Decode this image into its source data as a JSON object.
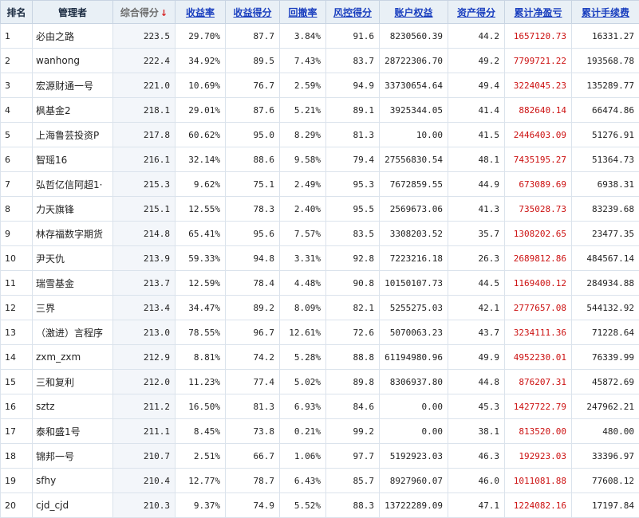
{
  "headers": {
    "rank": "排名",
    "manager": "管理者",
    "score": "综合得分",
    "sort_arrow": "↓",
    "return_rate": "收益率",
    "return_score": "收益得分",
    "drawdown": "回撤率",
    "risk_score": "风控得分",
    "equity": "账户权益",
    "asset_score": "资产得分",
    "net_profit": "累计净盈亏",
    "fees": "累计手续费"
  },
  "rows": [
    {
      "rank": "1",
      "manager": "必由之路",
      "score": "223.5",
      "return_rate": "29.70%",
      "return_score": "87.7",
      "drawdown": "3.84%",
      "risk_score": "91.6",
      "equity": "8230560.39",
      "asset_score": "44.2",
      "net_profit": "1657120.73",
      "fees": "16331.27"
    },
    {
      "rank": "2",
      "manager": "wanhong",
      "score": "222.4",
      "return_rate": "34.92%",
      "return_score": "89.5",
      "drawdown": "7.43%",
      "risk_score": "83.7",
      "equity": "28722306.70",
      "asset_score": "49.2",
      "net_profit": "7799721.22",
      "fees": "193568.78"
    },
    {
      "rank": "3",
      "manager": "宏源财通一号",
      "score": "221.0",
      "return_rate": "10.69%",
      "return_score": "76.7",
      "drawdown": "2.59%",
      "risk_score": "94.9",
      "equity": "33730654.64",
      "asset_score": "49.4",
      "net_profit": "3224045.23",
      "fees": "135289.77"
    },
    {
      "rank": "4",
      "manager": "枫基金2",
      "score": "218.1",
      "return_rate": "29.01%",
      "return_score": "87.6",
      "drawdown": "5.21%",
      "risk_score": "89.1",
      "equity": "3925344.05",
      "asset_score": "41.4",
      "net_profit": "882640.14",
      "fees": "66474.86"
    },
    {
      "rank": "5",
      "manager": "上海鲁芸投资P",
      "score": "217.8",
      "return_rate": "60.62%",
      "return_score": "95.0",
      "drawdown": "8.29%",
      "risk_score": "81.3",
      "equity": "10.00",
      "asset_score": "41.5",
      "net_profit": "2446403.09",
      "fees": "51276.91"
    },
    {
      "rank": "6",
      "manager": "智瑶16",
      "score": "216.1",
      "return_rate": "32.14%",
      "return_score": "88.6",
      "drawdown": "9.58%",
      "risk_score": "79.4",
      "equity": "27556830.54",
      "asset_score": "48.1",
      "net_profit": "7435195.27",
      "fees": "51364.73"
    },
    {
      "rank": "7",
      "manager": "弘哲亿信阿超1·",
      "score": "215.3",
      "return_rate": "9.62%",
      "return_score": "75.1",
      "drawdown": "2.49%",
      "risk_score": "95.3",
      "equity": "7672859.55",
      "asset_score": "44.9",
      "net_profit": "673089.69",
      "fees": "6938.31"
    },
    {
      "rank": "8",
      "manager": "力天旗锋",
      "score": "215.1",
      "return_rate": "12.55%",
      "return_score": "78.3",
      "drawdown": "2.40%",
      "risk_score": "95.5",
      "equity": "2569673.06",
      "asset_score": "41.3",
      "net_profit": "735028.73",
      "fees": "83239.68"
    },
    {
      "rank": "9",
      "manager": "林存福数字期货",
      "score": "214.8",
      "return_rate": "65.41%",
      "return_score": "95.6",
      "drawdown": "7.57%",
      "risk_score": "83.5",
      "equity": "3308203.52",
      "asset_score": "35.7",
      "net_profit": "1308202.65",
      "fees": "23477.35"
    },
    {
      "rank": "10",
      "manager": "尹天仇",
      "score": "213.9",
      "return_rate": "59.33%",
      "return_score": "94.8",
      "drawdown": "3.31%",
      "risk_score": "92.8",
      "equity": "7223216.18",
      "asset_score": "26.3",
      "net_profit": "2689812.86",
      "fees": "484567.14"
    },
    {
      "rank": "11",
      "manager": "瑞雪基金",
      "score": "213.7",
      "return_rate": "12.59%",
      "return_score": "78.4",
      "drawdown": "4.48%",
      "risk_score": "90.8",
      "equity": "10150107.73",
      "asset_score": "44.5",
      "net_profit": "1169400.12",
      "fees": "284934.88"
    },
    {
      "rank": "12",
      "manager": "三界",
      "score": "213.4",
      "return_rate": "34.47%",
      "return_score": "89.2",
      "drawdown": "8.09%",
      "risk_score": "82.1",
      "equity": "5255275.03",
      "asset_score": "42.1",
      "net_profit": "2777657.08",
      "fees": "544132.92"
    },
    {
      "rank": "13",
      "manager": "（激进）言程序",
      "score": "213.0",
      "return_rate": "78.55%",
      "return_score": "96.7",
      "drawdown": "12.61%",
      "risk_score": "72.6",
      "equity": "5070063.23",
      "asset_score": "43.7",
      "net_profit": "3234111.36",
      "fees": "71228.64"
    },
    {
      "rank": "14",
      "manager": "zxm_zxm",
      "score": "212.9",
      "return_rate": "8.81%",
      "return_score": "74.2",
      "drawdown": "5.28%",
      "risk_score": "88.8",
      "equity": "61194980.96",
      "asset_score": "49.9",
      "net_profit": "4952230.01",
      "fees": "76339.99"
    },
    {
      "rank": "15",
      "manager": "三和复利",
      "score": "212.0",
      "return_rate": "11.23%",
      "return_score": "77.4",
      "drawdown": "5.02%",
      "risk_score": "89.8",
      "equity": "8306937.80",
      "asset_score": "44.8",
      "net_profit": "876207.31",
      "fees": "45872.69"
    },
    {
      "rank": "16",
      "manager": "sztz",
      "score": "211.2",
      "return_rate": "16.50%",
      "return_score": "81.3",
      "drawdown": "6.93%",
      "risk_score": "84.6",
      "equity": "0.00",
      "asset_score": "45.3",
      "net_profit": "1427722.79",
      "fees": "247962.21"
    },
    {
      "rank": "17",
      "manager": "泰和盛1号",
      "score": "211.1",
      "return_rate": "8.45%",
      "return_score": "73.8",
      "drawdown": "0.21%",
      "risk_score": "99.2",
      "equity": "0.00",
      "asset_score": "38.1",
      "net_profit": "813520.00",
      "fees": "480.00"
    },
    {
      "rank": "18",
      "manager": "锦邦一号",
      "score": "210.7",
      "return_rate": "2.51%",
      "return_score": "66.7",
      "drawdown": "1.06%",
      "risk_score": "97.7",
      "equity": "5192923.03",
      "asset_score": "46.3",
      "net_profit": "192923.03",
      "fees": "33396.97"
    },
    {
      "rank": "19",
      "manager": "sfhy",
      "score": "210.4",
      "return_rate": "12.77%",
      "return_score": "78.7",
      "drawdown": "6.43%",
      "risk_score": "85.7",
      "equity": "8927960.07",
      "asset_score": "46.0",
      "net_profit": "1011081.88",
      "fees": "77608.12"
    },
    {
      "rank": "20",
      "manager": "cjd_cjd",
      "score": "210.3",
      "return_rate": "9.37%",
      "return_score": "74.9",
      "drawdown": "5.52%",
      "risk_score": "88.3",
      "equity": "13722289.09",
      "asset_score": "47.1",
      "net_profit": "1224082.16",
      "fees": "17197.84"
    }
  ],
  "colors": {
    "header_bg": "#e9f0f6",
    "link_header": "#1a3fbf",
    "sort_arrow": "#d62020",
    "profit_text": "#cc1111"
  }
}
